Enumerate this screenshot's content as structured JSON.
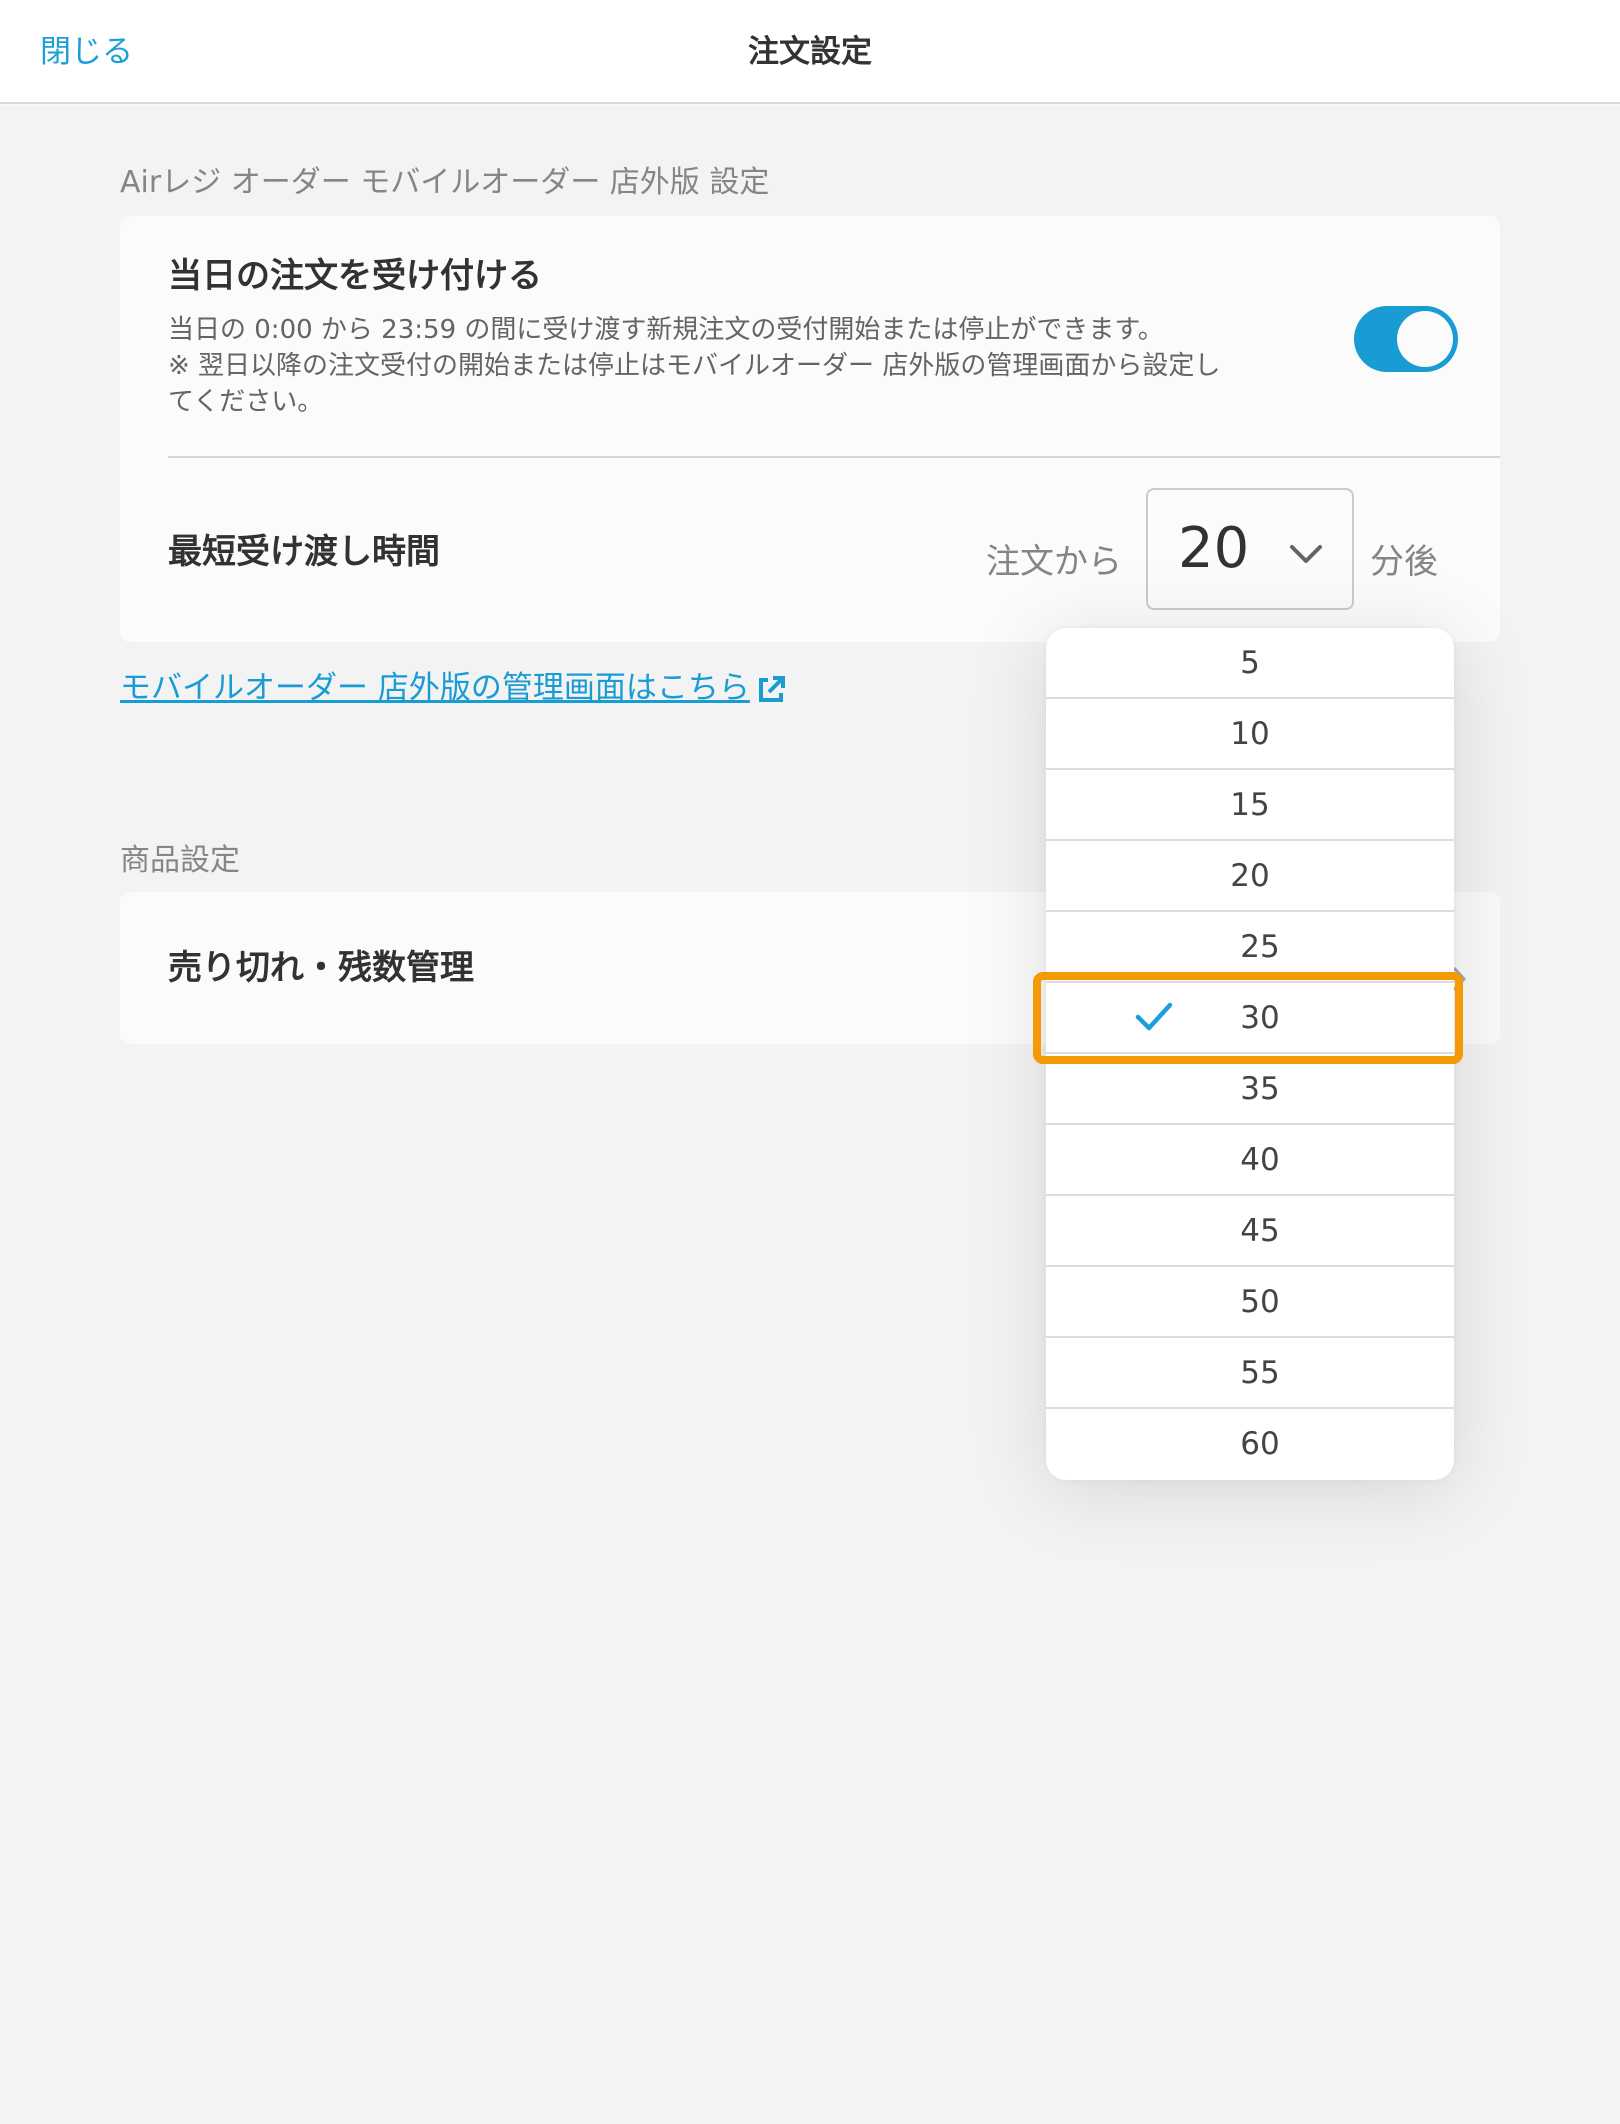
{
  "header": {
    "close_label": "閉じる",
    "title": "注文設定"
  },
  "section_order": {
    "label": "Airレジ オーダー モバイルオーダー 店外版 設定",
    "accept_today": {
      "title": "当日の注文を受け付ける",
      "desc_line1": "当日の 0:00 から 23:59 の間に受け渡す新規注文の受付開始または停止ができます。",
      "desc_line2": "※ 翌日以降の注文受付の開始または停止はモバイルオーダー 店外版の管理画面から設定し",
      "desc_line3": "てください。",
      "toggle_on": true
    },
    "min_time": {
      "title": "最短受け渡し時間",
      "prefix": "注文から",
      "value": "20",
      "suffix": "分後"
    }
  },
  "admin_link": "モバイルオーダー 店外版の管理画面はこちら",
  "section_product": {
    "label": "商品設定",
    "soldout_title": "売り切れ・残数管理"
  },
  "dropdown": {
    "options": [
      "5",
      "10",
      "15",
      "20",
      "25",
      "30",
      "35",
      "40",
      "45",
      "50",
      "55",
      "60"
    ],
    "selected": "30"
  },
  "colors": {
    "accent": "#1a9fd8",
    "highlight": "#f59a07"
  }
}
